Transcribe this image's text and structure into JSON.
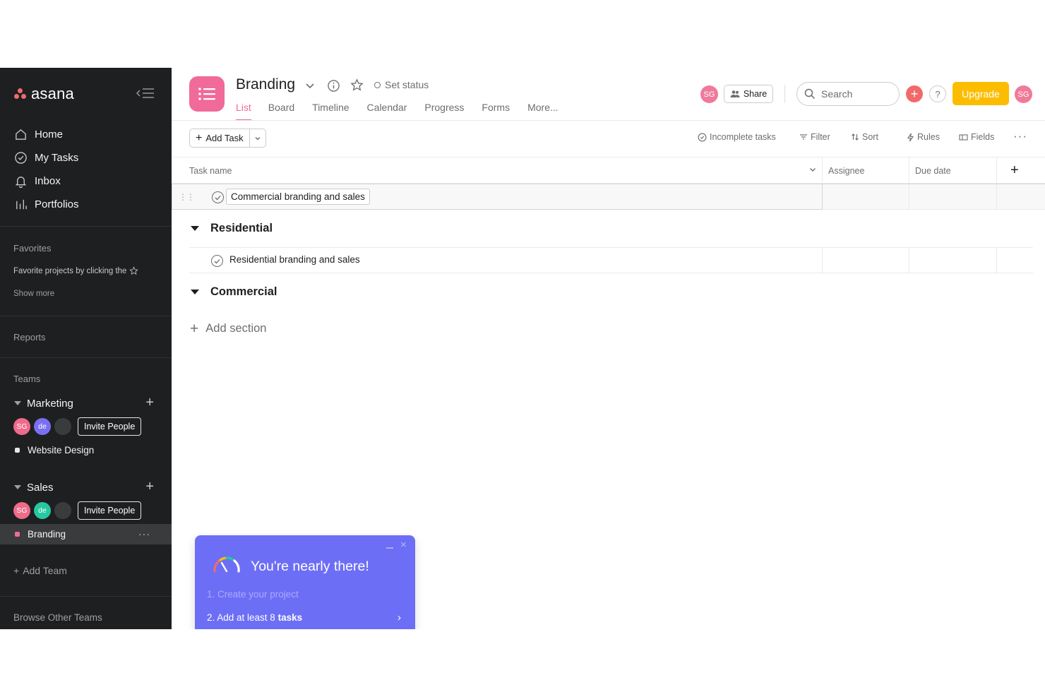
{
  "sidebar": {
    "logo": "asana",
    "nav": [
      {
        "label": "Home",
        "icon": "home-icon"
      },
      {
        "label": "My Tasks",
        "icon": "check-circle-icon"
      },
      {
        "label": "Inbox",
        "icon": "bell-icon"
      },
      {
        "label": "Portfolios",
        "icon": "bar-chart-icon"
      }
    ],
    "favorites_title": "Favorites",
    "favorites_hint": "Favorite projects by clicking the",
    "show_more": "Show more",
    "reports": "Reports",
    "teams_title": "Teams",
    "teams": [
      {
        "name": "Marketing",
        "members": [
          {
            "initials": "SG",
            "color": "#f06a8a"
          },
          {
            "initials": "de",
            "color": "#7a6ff0"
          },
          {
            "initials": "",
            "color": "#3a3b3d"
          }
        ],
        "invite_label": "Invite People",
        "projects": [
          {
            "name": "Website Design",
            "color": "#e6e6e6"
          }
        ]
      },
      {
        "name": "Sales",
        "members": [
          {
            "initials": "SG",
            "color": "#f06a8a"
          },
          {
            "initials": "de",
            "color": "#25c8a0"
          },
          {
            "initials": "",
            "color": "#3a3b3d"
          }
        ],
        "invite_label": "Invite People",
        "projects": [
          {
            "name": "Branding",
            "color": "#f06a9a",
            "more": "···"
          }
        ]
      }
    ],
    "add_team": "Add Team",
    "browse": "Browse Other Teams"
  },
  "header": {
    "project_title": "Branding",
    "set_status": "Set status",
    "tabs": [
      "List",
      "Board",
      "Timeline",
      "Calendar",
      "Progress",
      "Forms",
      "More..."
    ],
    "active_tab": "List",
    "avatar_initials": "SG",
    "share_label": "Share",
    "search_placeholder": "Search",
    "help_label": "?",
    "upgrade_label": "Upgrade",
    "accent": "#f06a9a",
    "upgrade_color": "#fcbd01"
  },
  "toolbar": {
    "add_task": "Add Task",
    "incomplete": "Incomplete tasks",
    "filter": "Filter",
    "sort": "Sort",
    "rules": "Rules",
    "fields": "Fields",
    "more": "···"
  },
  "table": {
    "columns": {
      "task_name": "Task name",
      "assignee": "Assignee",
      "due_date": "Due date"
    },
    "untitled_tasks": [
      "Commercial branding and sales"
    ],
    "sections": [
      {
        "name": "Residential",
        "tasks": [
          "Residential branding and sales"
        ]
      },
      {
        "name": "Commercial",
        "tasks": []
      }
    ],
    "add_section": "Add section"
  },
  "popup": {
    "title": "You're nearly there!",
    "step1": "1.  Create your project",
    "step2_prefix": "2.  Add at least 8 ",
    "step2_bold": "tasks",
    "arrow": "›",
    "close": "×"
  }
}
